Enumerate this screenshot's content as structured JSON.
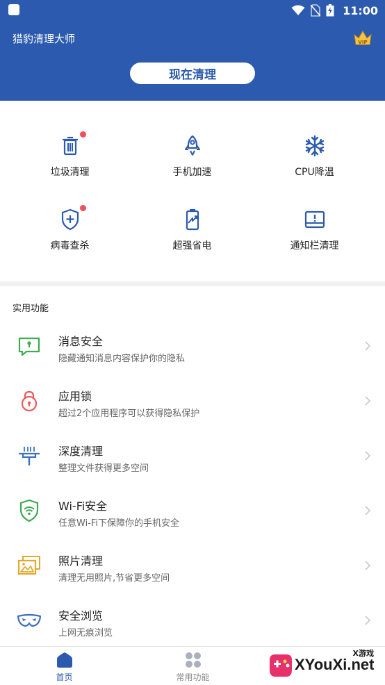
{
  "status_bar": {
    "time": "11:00"
  },
  "header": {
    "app_title": "猎豹清理大师",
    "vip_label": "VIP",
    "clean_button": "现在清理",
    "bg_color": "#2B5AAE"
  },
  "grid": [
    {
      "label": "垃圾清理",
      "icon": "trash-icon",
      "badge": true
    },
    {
      "label": "手机加速",
      "icon": "rocket-icon",
      "badge": false
    },
    {
      "label": "CPU降温",
      "icon": "snowflake-icon",
      "badge": false
    },
    {
      "label": "病毒查杀",
      "icon": "shield-plus-icon",
      "badge": true
    },
    {
      "label": "超强省电",
      "icon": "battery-icon",
      "badge": false
    },
    {
      "label": "通知栏清理",
      "icon": "notification-tray-icon",
      "badge": false
    }
  ],
  "section": {
    "title": "实用功能"
  },
  "list": [
    {
      "title": "消息安全",
      "desc": "隐藏通知消息内容保护你的隐私",
      "icon": "message-lock-icon",
      "color": "#3DAA4F"
    },
    {
      "title": "应用锁",
      "desc": "超过2个应用程序可以获得隐私保护",
      "icon": "padlock-icon",
      "color": "#EE5A5A"
    },
    {
      "title": "深度清理",
      "desc": "整理文件获得更多空间",
      "icon": "brush-icon",
      "color": "#3E6FC0"
    },
    {
      "title": "Wi-Fi安全",
      "desc": "任意Wi-Fi下保障你的手机安全",
      "icon": "wifi-shield-icon",
      "color": "#3DAA4F"
    },
    {
      "title": "照片清理",
      "desc": "清理无用照片,节省更多空间",
      "icon": "photos-icon",
      "color": "#E2A92A"
    },
    {
      "title": "安全浏览",
      "desc": "上网无痕浏览",
      "icon": "mask-icon",
      "color": "#3E6FC0"
    }
  ],
  "bottom_nav": [
    {
      "label": "首页",
      "icon": "home-icon",
      "active": true
    },
    {
      "label": "常用功能",
      "icon": "apps-icon",
      "active": false
    }
  ],
  "watermark": {
    "text": "XYouXi.net",
    "small": "X游戏"
  }
}
